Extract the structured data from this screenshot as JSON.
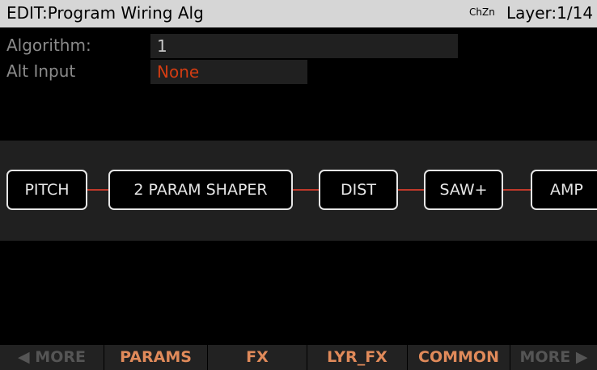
{
  "header": {
    "title": "EDIT:Program Wiring Alg",
    "chzn_icon": "ChZn",
    "layer": "Layer:1/14"
  },
  "fields": {
    "algorithm": {
      "label": "Algorithm:",
      "value": "1"
    },
    "alt_input": {
      "label": "Alt Input",
      "value": "None",
      "value_color": "#d23c12"
    }
  },
  "modules": [
    "PITCH",
    "2 PARAM SHAPER",
    "DIST",
    "SAW+",
    "AMP"
  ],
  "softkeys": {
    "more_left": "MORE",
    "params": "PARAMS",
    "fx": "FX",
    "lyr_fx": "LYR_FX",
    "common": "COMMON",
    "more_right": "MORE"
  },
  "colors": {
    "accent": "#e08a5a",
    "wire": "#c0392b"
  }
}
